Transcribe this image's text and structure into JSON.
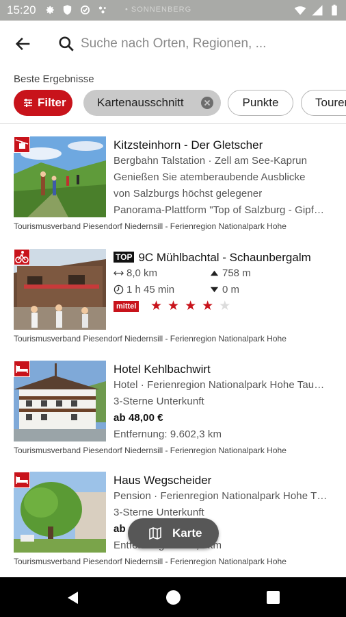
{
  "status_bar": {
    "time": "15:20",
    "ghost_text": "• SONNENBERG",
    "icons": [
      "gear-icon",
      "shield-icon",
      "sync-icon",
      "dots-icon",
      "wifi-icon",
      "signal-icon",
      "battery-icon"
    ]
  },
  "search": {
    "placeholder": "Suche nach Orten, Regionen, ...",
    "value": ""
  },
  "section_label": "Beste Ergebnisse",
  "chips": {
    "filter": "Filter",
    "map_section": "Kartenausschnitt",
    "points": "Punkte",
    "tours": "Touren"
  },
  "results": [
    {
      "category_icon": "cable-car-icon",
      "title": "Kitzsteinhorn - Der Gletscher",
      "subtitle": "Bergbahn Talstation · Zell am See-Kaprun",
      "description_1": "Genießen Sie atemberaubende Ausblicke",
      "description_2": "von Salzburgs höchst gelegener",
      "description_3": "Panorama-Plattform \"Top of Salzburg - Gipf…",
      "source": "Tourismusverband Piesendorf Niedernsill - Ferienregion Nationalpark Hohe"
    },
    {
      "category_icon": "bike-icon",
      "badge": "TOP",
      "title": "9C Mühlbachtal - Schaunbergalm",
      "distance": "8,0 km",
      "ascent": "758 m",
      "duration": "1 h 45 min",
      "descent": "0 m",
      "difficulty": "mittel",
      "rating": 4,
      "rating_max": 5,
      "source": "Tourismusverband Piesendorf Niedernsill - Ferienregion Nationalpark Hohe"
    },
    {
      "category_icon": "bed-icon",
      "title": "Hotel Kehlbachwirt",
      "subtitle": "Hotel · Ferienregion Nationalpark Hohe Tau…",
      "stars_text": "3-Sterne Unterkunft",
      "price": "ab 48,00 €",
      "distance": "Entfernung: 9.602,3 km",
      "source": "Tourismusverband Piesendorf Niedernsill - Ferienregion Nationalpark Hohe"
    },
    {
      "category_icon": "bed-icon",
      "title": "Haus Wegscheider",
      "subtitle": "Pension · Ferienregion Nationalpark Hohe T…",
      "stars_text": "3-Sterne Unterkunft",
      "price": "ab",
      "distance": "Entfernung: 9.602,3 km",
      "source": "Tourismusverband Piesendorf Niedernsill - Ferienregion Nationalpark Hohe"
    }
  ],
  "map_button": "Karte",
  "colors": {
    "accent": "#c8131b",
    "chip_grey": "#c9c9c9",
    "fab": "#575757"
  }
}
